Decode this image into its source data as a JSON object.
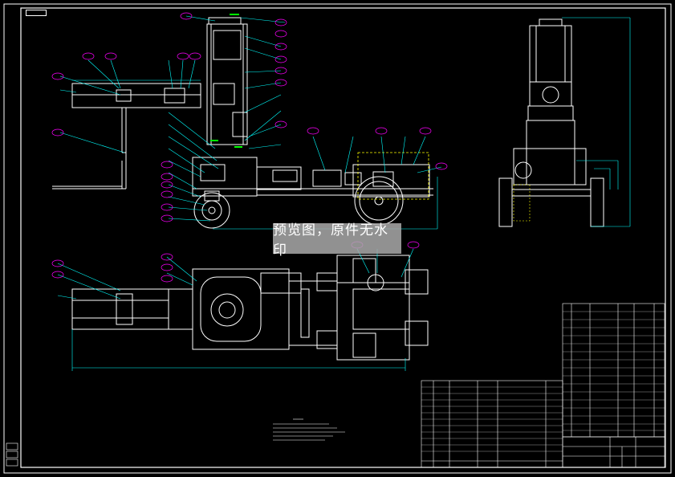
{
  "watermark": {
    "text": "预览图，原件无水印"
  },
  "frame": {
    "tag": ""
  },
  "colors": {
    "background": "#000000",
    "lines": "#ffffff",
    "dimensions": "#00ffff",
    "callouts": "#ff00ff",
    "labels": "#00ff00",
    "hidden": "#ffff00",
    "watermark_bg": "#aaaaaa"
  }
}
